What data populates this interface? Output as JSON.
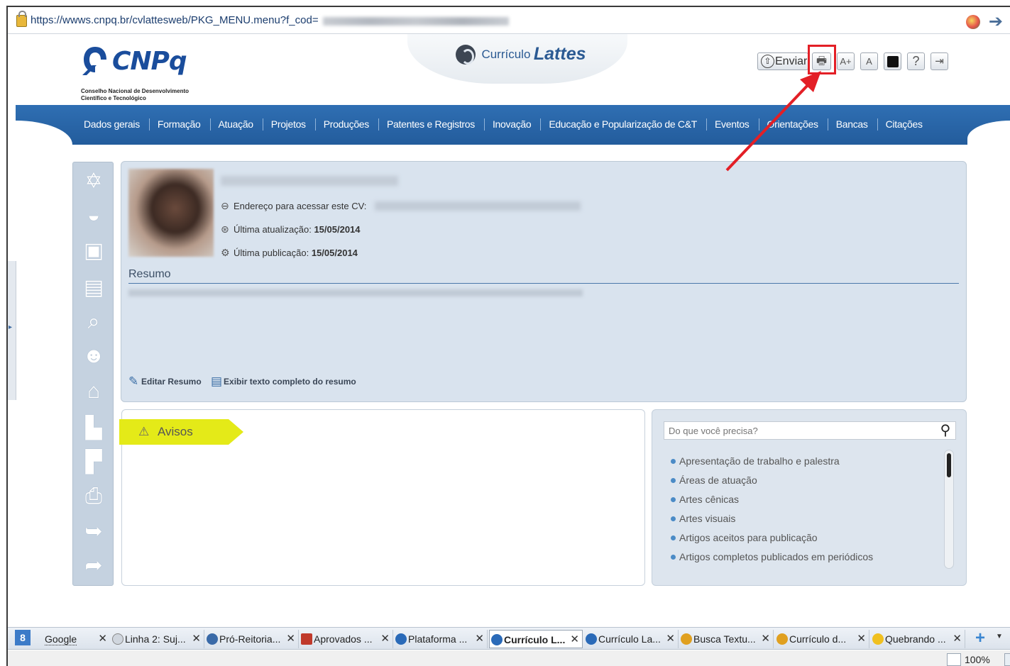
{
  "browser": {
    "url": "https://wwws.cnpq.br/cvlattesweb/PKG_MENU.menu?f_cod=",
    "zoom": "100%"
  },
  "header": {
    "logo_name": "CNPq",
    "logo_sub_line1": "Conselho Nacional de Desenvolvimento",
    "logo_sub_line2": "Científico e Tecnológico",
    "lattes_prefix": "Currículo",
    "lattes_name": "Lattes",
    "tools": {
      "send_label": "Enviar",
      "font_bigger": "A+",
      "font_normal": "A",
      "help": "?"
    }
  },
  "nav": {
    "items": [
      "Dados gerais",
      "Formação",
      "Atuação",
      "Projetos",
      "Produções",
      "Patentes e Registros",
      "Inovação",
      "Educação e Popularização de C&T",
      "Eventos",
      "Orientações",
      "Bancas",
      "Citações"
    ]
  },
  "profile": {
    "cv_address_label": "Endereço para acessar este CV:",
    "last_update_label": "Última atualização:",
    "last_update_value": "15/05/2014",
    "last_publish_label": "Última publicação:",
    "last_publish_value": "15/05/2014",
    "resumo_title": "Resumo",
    "edit_resumo": "Editar Resumo",
    "show_full_resumo": "Exibir texto completo do resumo"
  },
  "avisos": {
    "title": "Avisos"
  },
  "search": {
    "placeholder": "Do que você precisa?",
    "items": [
      "Apresentação de trabalho e palestra",
      "Áreas de atuação",
      "Artes cênicas",
      "Artes visuais",
      "Artigos aceitos para publicação",
      "Artigos completos publicados em periódicos"
    ]
  },
  "tabs": [
    {
      "label": "Google",
      "favicon_color": "#3c7bc8",
      "active": false
    },
    {
      "label": "Linha 2: Suj...",
      "favicon_color": "#9aa6b4",
      "active": false
    },
    {
      "label": "Pró-Reitoria...",
      "favicon_color": "#3a6aa8",
      "active": false
    },
    {
      "label": "Aprovados ...",
      "favicon_color": "#c0392b",
      "active": false
    },
    {
      "label": "Plataforma ...",
      "favicon_color": "#2a6ab8",
      "active": false
    },
    {
      "label": "Currículo L...",
      "favicon_color": "#2a6ab8",
      "active": true
    },
    {
      "label": "Currículo La...",
      "favicon_color": "#2a6ab8",
      "active": false
    },
    {
      "label": "Busca Textu...",
      "favicon_color": "#e0a020",
      "active": false
    },
    {
      "label": "Currículo d...",
      "favicon_color": "#e0a020",
      "active": false
    },
    {
      "label": "Quebrando ...",
      "favicon_color": "#f0c020",
      "active": false
    }
  ],
  "colors": {
    "nav_blue": "#2f6fb3",
    "highlight_red": "#e31f26",
    "avisos_yellow": "#e4ea18"
  }
}
